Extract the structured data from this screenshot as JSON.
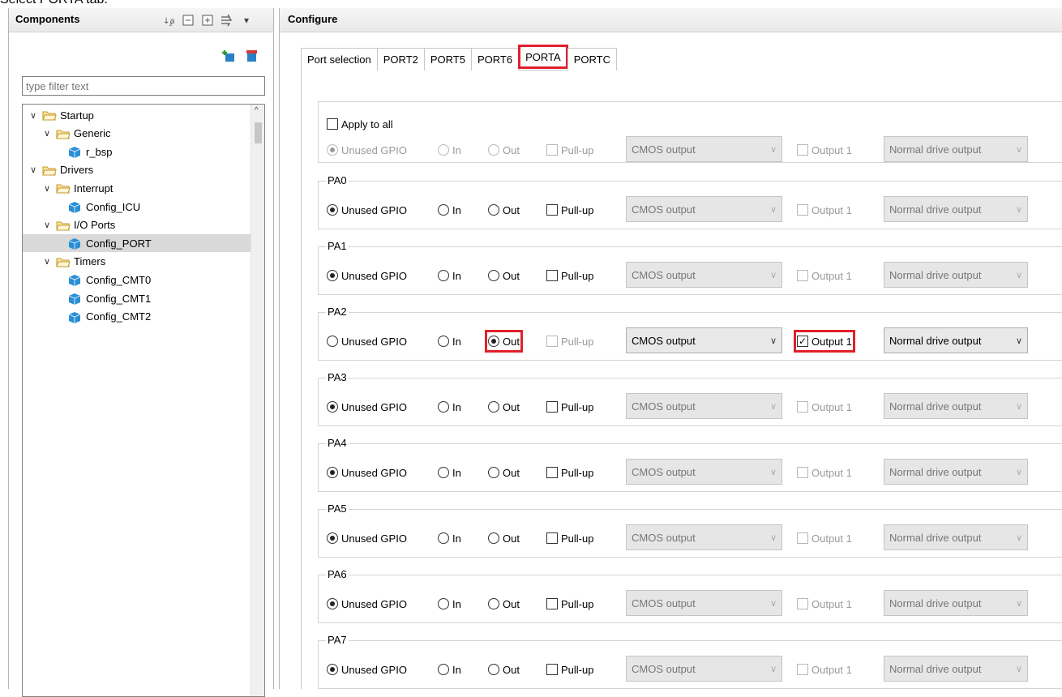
{
  "caption": "Select PORTA tab.",
  "left": {
    "title": "Components",
    "filter_placeholder": "type filter text",
    "tree": [
      {
        "label": "Startup",
        "kind": "folder",
        "level": 0
      },
      {
        "label": "Generic",
        "kind": "folder",
        "level": 1
      },
      {
        "label": "r_bsp",
        "kind": "component",
        "level": 2
      },
      {
        "label": "Drivers",
        "kind": "folder",
        "level": 0
      },
      {
        "label": "Interrupt",
        "kind": "folder",
        "level": 1
      },
      {
        "label": "Config_ICU",
        "kind": "component",
        "level": 2
      },
      {
        "label": "I/O Ports",
        "kind": "folder",
        "level": 1
      },
      {
        "label": "Config_PORT",
        "kind": "component",
        "level": 2,
        "selected": true
      },
      {
        "label": "Timers",
        "kind": "folder",
        "level": 1
      },
      {
        "label": "Config_CMT0",
        "kind": "component",
        "level": 2
      },
      {
        "label": "Config_CMT1",
        "kind": "component",
        "level": 2
      },
      {
        "label": "Config_CMT2",
        "kind": "component",
        "level": 2
      }
    ]
  },
  "right": {
    "title": "Configure",
    "tabs": [
      "Port selection",
      "PORT2",
      "PORT5",
      "PORT6",
      "PORTA",
      "PORTC"
    ],
    "active_tab": "PORTA",
    "apply_all": {
      "label": "Apply to all",
      "unused": "Unused GPIO",
      "in": "In",
      "out": "Out",
      "pullup": "Pull-up",
      "cmos": "CMOS output",
      "output1": "Output 1",
      "drive": "Normal drive output"
    },
    "labels": {
      "unused": "Unused GPIO",
      "in": "In",
      "out": "Out",
      "pullup": "Pull-up",
      "cmos": "CMOS output",
      "output1": "Output 1",
      "drive": "Normal drive output"
    },
    "pins": [
      {
        "name": "PA0",
        "mode": "unused",
        "output1": false
      },
      {
        "name": "PA1",
        "mode": "unused",
        "output1": false
      },
      {
        "name": "PA2",
        "mode": "out",
        "output1": true
      },
      {
        "name": "PA3",
        "mode": "unused",
        "output1": false
      },
      {
        "name": "PA4",
        "mode": "unused",
        "output1": false
      },
      {
        "name": "PA5",
        "mode": "unused",
        "output1": false
      },
      {
        "name": "PA6",
        "mode": "unused",
        "output1": false
      },
      {
        "name": "PA7",
        "mode": "unused",
        "output1": false
      }
    ]
  },
  "colors": {
    "highlight": "#e0202b",
    "selected_row": "#d9d9d9"
  }
}
